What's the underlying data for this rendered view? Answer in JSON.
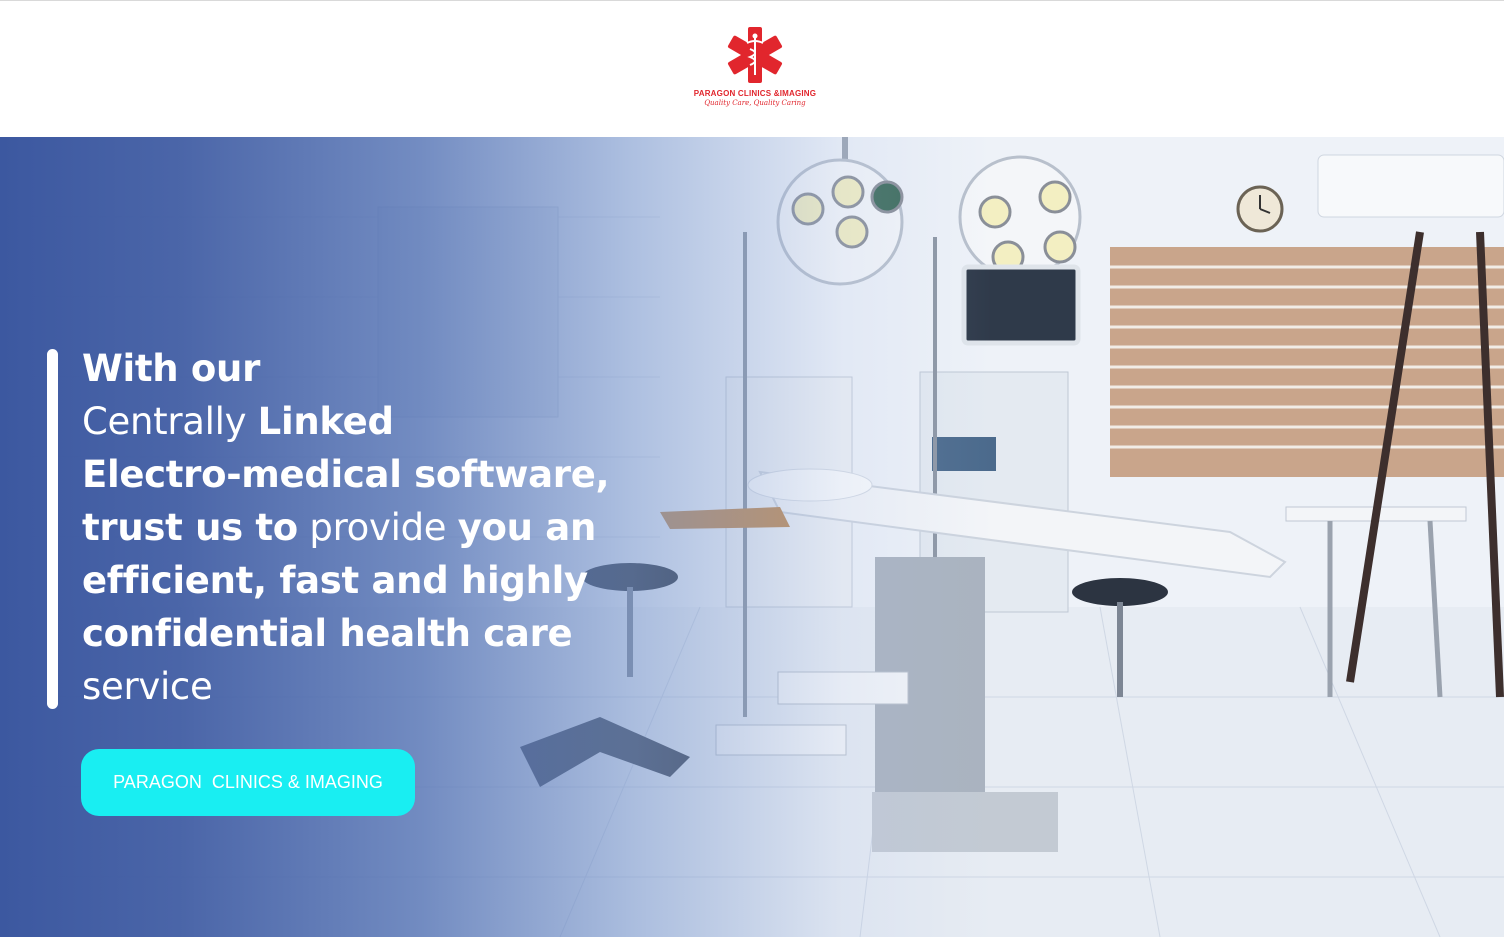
{
  "brand": {
    "name": "PARAGON CLINICS &IMAGING",
    "tagline": "Quality Care, Quality Caring",
    "colors": {
      "logo_red": "#e1262d",
      "overlay_blue": "#3c58a0",
      "cta_cyan": "#19eef2"
    }
  },
  "hero": {
    "headline": [
      [
        "With our",
        ""
      ],
      [
        "Centrally ",
        "Linked"
      ],
      [
        "Electro-medical software,",
        ""
      ],
      [
        "trust us to ",
        "provide ",
        "you an"
      ],
      [
        "efficient, fast and highly",
        ""
      ],
      [
        "confidential health care",
        ""
      ],
      [
        "service"
      ]
    ],
    "line1": "With our",
    "line2a": "Centrally",
    "line2b": "Linked",
    "line3": "Electro-medical software,",
    "line4a": "trust us to",
    "line4b": "provide",
    "line4c": "you an",
    "line5": "efficient, fast and highly",
    "line6": "confidential health care",
    "line7": "service",
    "background": "operating-room-photo",
    "cta_label": "PARAGON  CLINICS & IMAGING"
  }
}
